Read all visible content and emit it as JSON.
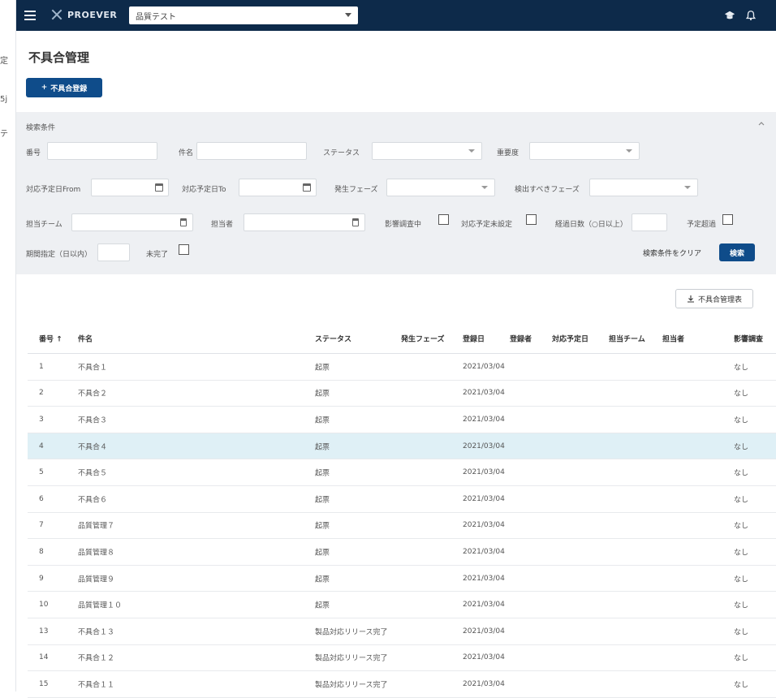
{
  "left_strip": [
    "定",
    "5j",
    "テ"
  ],
  "header": {
    "brand": "PROEVER",
    "project_value": "品質テスト"
  },
  "page": {
    "title": "不具合管理",
    "create_button": "不具合登録"
  },
  "search": {
    "panel_title": "検索条件",
    "labels": {
      "number": "番号",
      "subject": "件名",
      "status": "ステータス",
      "severity": "重要度",
      "due_from": "対応予定日From",
      "due_to": "対応予定日To",
      "phase": "発生フェーズ",
      "detected_phase": "検出すべきフェーズ",
      "team": "担当チーム",
      "owner": "担当者",
      "unconfirmed": "影響調査中",
      "not_scheduled": "対応予定未設定",
      "elapsed": "経過日数（○日以上）",
      "overdue": "予定超過",
      "period": "期間指定（日以内）",
      "incomplete": "未完了"
    },
    "clear_button": "検索条件をクリア",
    "search_button": "検索"
  },
  "export_button": "不具合管理表",
  "table": {
    "columns": [
      "番号",
      "件名",
      "ステータス",
      "発生フェーズ",
      "登録日",
      "登録者",
      "対応予定日",
      "担当チーム",
      "担当者",
      "影響調査"
    ],
    "rows": [
      {
        "no": "1",
        "name": "不具合１",
        "status": "起票",
        "reg": "2021/03/04",
        "impact": "なし"
      },
      {
        "no": "2",
        "name": "不具合２",
        "status": "起票",
        "reg": "2021/03/04",
        "impact": "なし"
      },
      {
        "no": "3",
        "name": "不具合３",
        "status": "起票",
        "reg": "2021/03/04",
        "impact": "なし"
      },
      {
        "no": "4",
        "name": "不具合４",
        "status": "起票",
        "reg": "2021/03/04",
        "impact": "なし"
      },
      {
        "no": "5",
        "name": "不具合５",
        "status": "起票",
        "reg": "2021/03/04",
        "impact": "なし"
      },
      {
        "no": "6",
        "name": "不具合６",
        "status": "起票",
        "reg": "2021/03/04",
        "impact": "なし"
      },
      {
        "no": "7",
        "name": "品質管理７",
        "status": "起票",
        "reg": "2021/03/04",
        "impact": "なし"
      },
      {
        "no": "8",
        "name": "品質管理８",
        "status": "起票",
        "reg": "2021/03/04",
        "impact": "なし"
      },
      {
        "no": "9",
        "name": "品質管理９",
        "status": "起票",
        "reg": "2021/03/04",
        "impact": "なし"
      },
      {
        "no": "10",
        "name": "品質管理１０",
        "status": "起票",
        "reg": "2021/03/04",
        "impact": "なし"
      },
      {
        "no": "13",
        "name": "不具合１３",
        "status": "製品対応リリース完了",
        "reg": "2021/03/04",
        "impact": "なし"
      },
      {
        "no": "14",
        "name": "不具合１２",
        "status": "製品対応リリース完了",
        "reg": "2021/03/04",
        "impact": "なし"
      },
      {
        "no": "15",
        "name": "不具合１１",
        "status": "製品対応リリース完了",
        "reg": "2021/03/04",
        "impact": "なし"
      }
    ]
  },
  "colors": {
    "header_bg": "#0d2a4a",
    "primary": "#0f4c8a",
    "panel_bg": "#eef0f3",
    "selected_row": "#dff0f6"
  },
  "icons": [
    "hamburger-icon",
    "logo-icon",
    "chevron-down-icon",
    "graduation-cap-icon",
    "bell-icon",
    "plus-icon",
    "calendar-icon",
    "trash-icon",
    "download-icon",
    "sort-icon"
  ]
}
